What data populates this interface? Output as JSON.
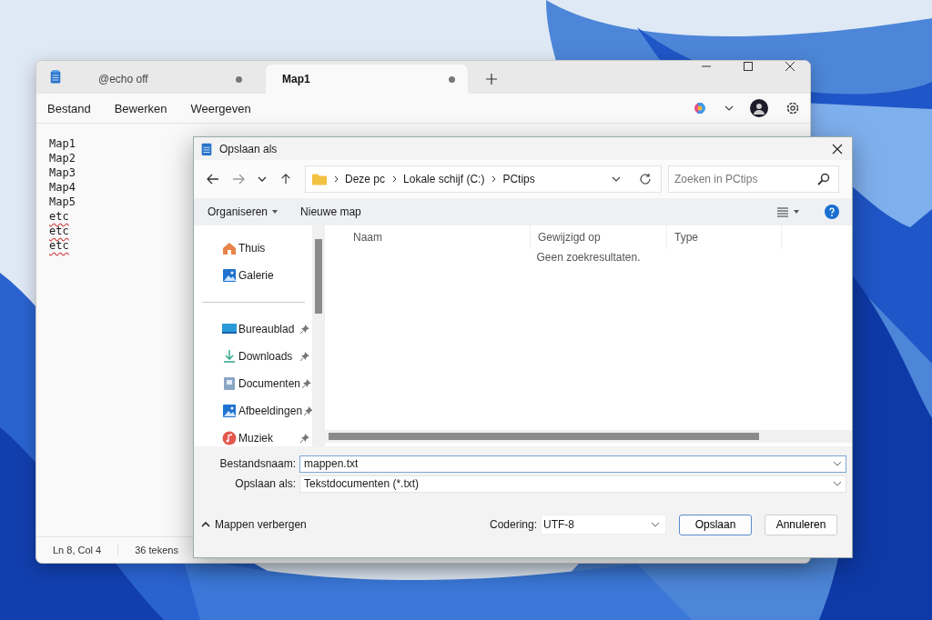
{
  "editor": {
    "tabs": [
      {
        "label": "@echo off",
        "selected": false,
        "modified": true
      },
      {
        "label": "Map1",
        "selected": true,
        "modified": true
      }
    ],
    "menu": [
      "Bestand",
      "Bewerken",
      "Weergeven"
    ],
    "lines": [
      {
        "text": "Map1",
        "misspelled": false
      },
      {
        "text": "Map2",
        "misspelled": false
      },
      {
        "text": "Map3",
        "misspelled": false
      },
      {
        "text": "Map4",
        "misspelled": false
      },
      {
        "text": "Map5",
        "misspelled": false
      },
      {
        "text": "etc",
        "misspelled": true
      },
      {
        "text": "etc",
        "misspelled": true
      },
      {
        "text": "etc",
        "misspelled": true
      }
    ],
    "status_bar": [
      "Ln 8, Col 4",
      "36 tekens"
    ]
  },
  "dialog": {
    "title": "Opslaan als",
    "nav": {
      "forward_disabled": true
    },
    "breadcrumb": [
      "Deze pc",
      "Lokale schijf (C:)",
      "PCtips"
    ],
    "search": {
      "placeholder": "Zoeken in PCtips"
    },
    "commands": [
      "Organiseren",
      "Nieuwe map"
    ],
    "sidebar": {
      "items": [
        {
          "label": "Thuis",
          "kind": "home",
          "pinned": false
        },
        {
          "label": "Galerie",
          "kind": "gallery",
          "pinned": false
        },
        {
          "label": "Bureaublad",
          "kind": "desktop",
          "pinned": true
        },
        {
          "label": "Downloads",
          "kind": "downloads",
          "pinned": true
        },
        {
          "label": "Documenten",
          "kind": "documents",
          "pinned": true
        },
        {
          "label": "Afbeeldingen",
          "kind": "pictures",
          "pinned": true
        },
        {
          "label": "Muziek",
          "kind": "music",
          "pinned": true
        }
      ]
    },
    "columns": [
      "Naam",
      "Gewijzigd op",
      "Type"
    ],
    "empty_message": "Geen zoekresultaten.",
    "fields": [
      {
        "label": "Bestandsnaam:",
        "value": "mappen.txt",
        "focused": true
      },
      {
        "label": "Opslaan als:",
        "value": "Tekstdocumenten (*.txt)",
        "focused": false
      }
    ],
    "toggle_folders": "Mappen verbergen",
    "encoding": {
      "label": "Codering:",
      "value": "UTF-8"
    },
    "buttons": [
      {
        "label": "Opslaan",
        "default": true
      },
      {
        "label": "Annuleren",
        "default": false
      }
    ]
  }
}
